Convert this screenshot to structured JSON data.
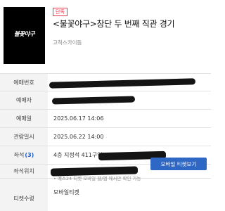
{
  "header": {
    "poster_logo": "불꽃야구",
    "badge": "단독",
    "title": "<불꽃야구>창단 두 번째 직관 경기",
    "venue": "고척스카이돔"
  },
  "rows": [
    {
      "label": "예매번호",
      "value": ""
    },
    {
      "label": "예매자",
      "value": ""
    },
    {
      "label": "예매일",
      "value": "2025.06.17 14:06"
    },
    {
      "label": "관람일시",
      "value": "2025.06.22 14:00"
    },
    {
      "label": "좌석",
      "count": "(3)",
      "value": "4층 지정석 411구역"
    },
    {
      "label": "좌석위치",
      "value": ""
    },
    {
      "label": "티켓수령",
      "value": "모바일티켓"
    }
  ],
  "mobile_ticket_button": "모바일 티켓보기",
  "notice": "• 예스24 티켓 모바일 웹/앱 에서만 확인 가능"
}
